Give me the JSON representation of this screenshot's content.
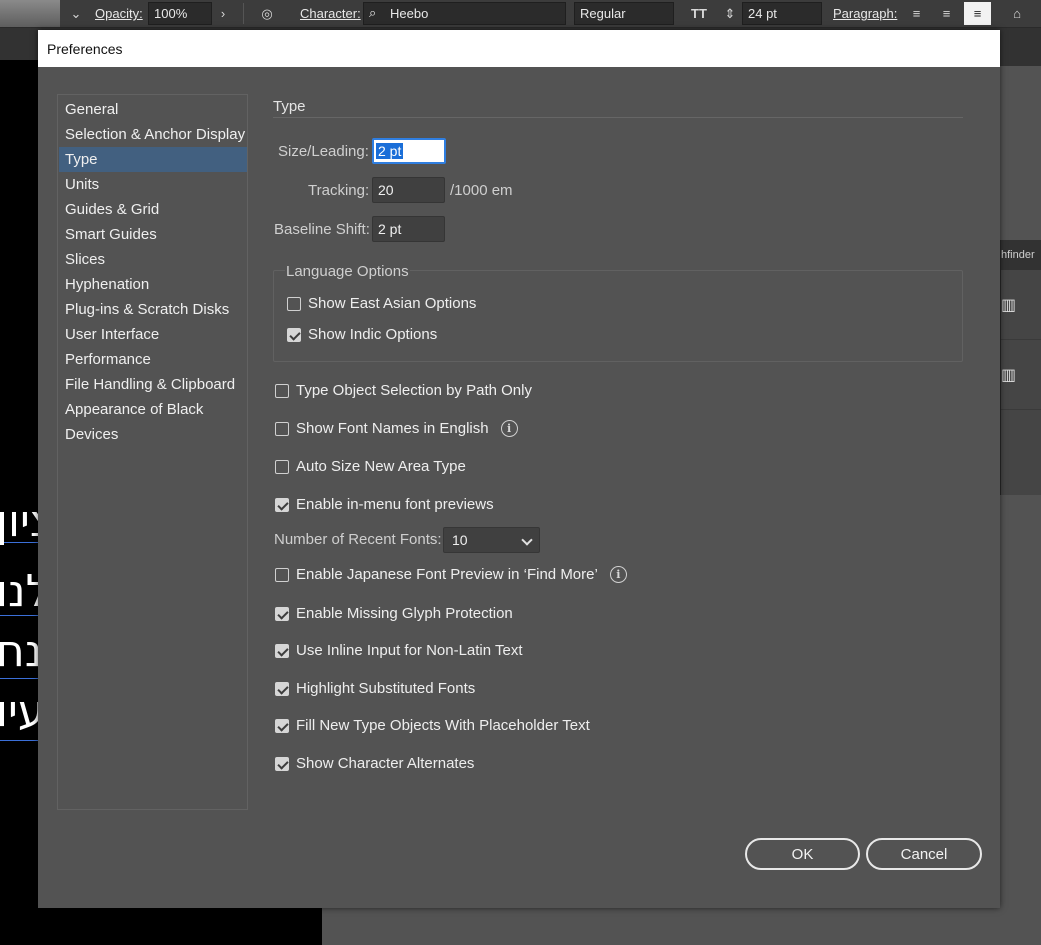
{
  "toolbar": {
    "opacity_label": "Opacity:",
    "opacity_value": "100%",
    "character_label": "Character:",
    "font_family": "Heebo",
    "font_style": "Regular",
    "font_size": "24 pt",
    "paragraph_label": "Paragraph:"
  },
  "canvas": {
    "hebrew_lines": [
      "ציון",
      "לנו",
      "מנח",
      "עיו"
    ]
  },
  "right_panel": {
    "pathfinder_label": "hfinder"
  },
  "dialog": {
    "title": "Preferences",
    "sidebar": [
      {
        "label": "General"
      },
      {
        "label": "Selection & Anchor Display"
      },
      {
        "label": "Type"
      },
      {
        "label": "Units"
      },
      {
        "label": "Guides & Grid"
      },
      {
        "label": "Smart Guides"
      },
      {
        "label": "Slices"
      },
      {
        "label": "Hyphenation"
      },
      {
        "label": "Plug-ins & Scratch Disks"
      },
      {
        "label": "User Interface"
      },
      {
        "label": "Performance"
      },
      {
        "label": "File Handling & Clipboard"
      },
      {
        "label": "Appearance of Black"
      },
      {
        "label": "Devices"
      }
    ],
    "selected_index": 2,
    "type_section": {
      "title": "Type",
      "size_leading_label": "Size/Leading:",
      "size_leading_value": "2 pt",
      "tracking_label": "Tracking:",
      "tracking_value": "20",
      "tracking_unit": "/1000 em",
      "baseline_shift_label": "Baseline Shift:",
      "baseline_shift_value": "2 pt",
      "language_options": {
        "title": "Language Options",
        "east_asian": {
          "label": "Show East Asian Options",
          "checked": false
        },
        "indic": {
          "label": "Show Indic Options",
          "checked": true
        }
      },
      "options": [
        {
          "label": "Type Object Selection by Path Only",
          "checked": false
        },
        {
          "label": "Show Font Names in English",
          "checked": false
        },
        {
          "label": "Auto Size New Area Type",
          "checked": false
        },
        {
          "label": "Enable in-menu font previews",
          "checked": true
        }
      ],
      "recent_fonts_label": "Number of Recent Fonts:",
      "recent_fonts_value": "10",
      "options2": [
        {
          "label": "Enable Japanese Font Preview in ‘Find More’",
          "checked": false
        },
        {
          "label": "Enable Missing Glyph Protection",
          "checked": true
        },
        {
          "label": "Use Inline Input for Non-Latin Text",
          "checked": true
        },
        {
          "label": "Highlight Substituted Fonts",
          "checked": true
        },
        {
          "label": "Fill New Type Objects With Placeholder Text",
          "checked": true
        },
        {
          "label": "Show Character Alternates",
          "checked": true
        }
      ]
    },
    "ok_label": "OK",
    "cancel_label": "Cancel"
  },
  "colors": {
    "selection": "#426080",
    "field_focus": "#2f7ee0",
    "dialog_bg": "#535353"
  }
}
